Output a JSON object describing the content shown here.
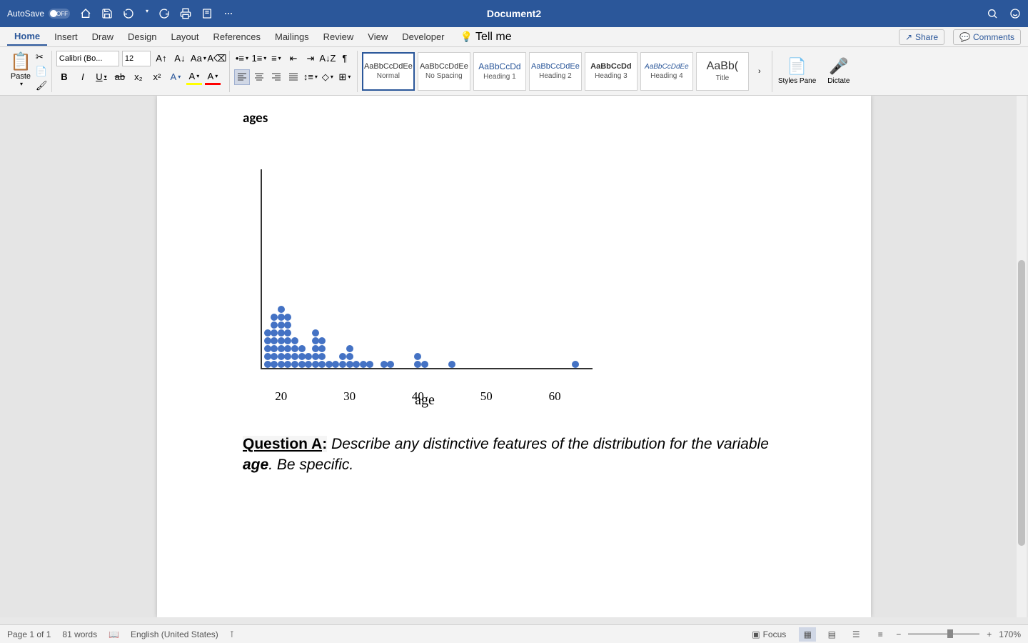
{
  "titlebar": {
    "autosave_label": "AutoSave",
    "autosave_state": "OFF",
    "doc_title": "Document2"
  },
  "tabs": {
    "home": "Home",
    "insert": "Insert",
    "draw": "Draw",
    "design": "Design",
    "layout": "Layout",
    "references": "References",
    "mailings": "Mailings",
    "review": "Review",
    "view": "View",
    "developer": "Developer",
    "tellme": "Tell me",
    "share": "Share",
    "comments": "Comments"
  },
  "ribbon": {
    "paste": "Paste",
    "font_name": "Calibri (Bo...",
    "font_size": "12",
    "styles": {
      "normal": {
        "preview": "AaBbCcDdEe",
        "name": "Normal"
      },
      "nospacing": {
        "preview": "AaBbCcDdEe",
        "name": "No Spacing"
      },
      "h1": {
        "preview": "AaBbCcDd",
        "name": "Heading 1"
      },
      "h2": {
        "preview": "AaBbCcDdEe",
        "name": "Heading 2"
      },
      "h3": {
        "preview": "AaBbCcDd",
        "name": "Heading 3"
      },
      "h4": {
        "preview": "AaBbCcDdEe",
        "name": "Heading 4"
      },
      "title": {
        "preview": "AaBb(",
        "name": "Title"
      }
    },
    "styles_pane": "Styles Pane",
    "dictate": "Dictate"
  },
  "document": {
    "heading": "ages",
    "question_label": "Question A",
    "question_colon": ":",
    "question_text1": "  Describe any distinctive features of the distribution for the variable ",
    "question_var": "age",
    "question_text2": ". Be specific.",
    "x_title": "age",
    "x_ticks": [
      "20",
      "30",
      "40",
      "50",
      "60"
    ]
  },
  "chart_data": {
    "type": "dotplot",
    "title": "ages",
    "xlabel": "age",
    "xlim": [
      17,
      65
    ],
    "x_ticks": [
      20,
      30,
      40,
      50,
      60
    ],
    "points": [
      {
        "x": 18,
        "count": 5
      },
      {
        "x": 19,
        "count": 7
      },
      {
        "x": 20,
        "count": 8
      },
      {
        "x": 21,
        "count": 7
      },
      {
        "x": 22,
        "count": 4
      },
      {
        "x": 23,
        "count": 3
      },
      {
        "x": 24,
        "count": 2
      },
      {
        "x": 25,
        "count": 5
      },
      {
        "x": 26,
        "count": 4
      },
      {
        "x": 27,
        "count": 1
      },
      {
        "x": 28,
        "count": 1
      },
      {
        "x": 29,
        "count": 2
      },
      {
        "x": 30,
        "count": 3
      },
      {
        "x": 31,
        "count": 1
      },
      {
        "x": 32,
        "count": 1
      },
      {
        "x": 33,
        "count": 1
      },
      {
        "x": 35,
        "count": 1
      },
      {
        "x": 36,
        "count": 1
      },
      {
        "x": 40,
        "count": 2
      },
      {
        "x": 41,
        "count": 1
      },
      {
        "x": 45,
        "count": 1
      },
      {
        "x": 63,
        "count": 1
      }
    ]
  },
  "statusbar": {
    "page": "Page 1 of 1",
    "words": "81 words",
    "language": "English (United States)",
    "focus": "Focus",
    "zoom": "170%"
  }
}
